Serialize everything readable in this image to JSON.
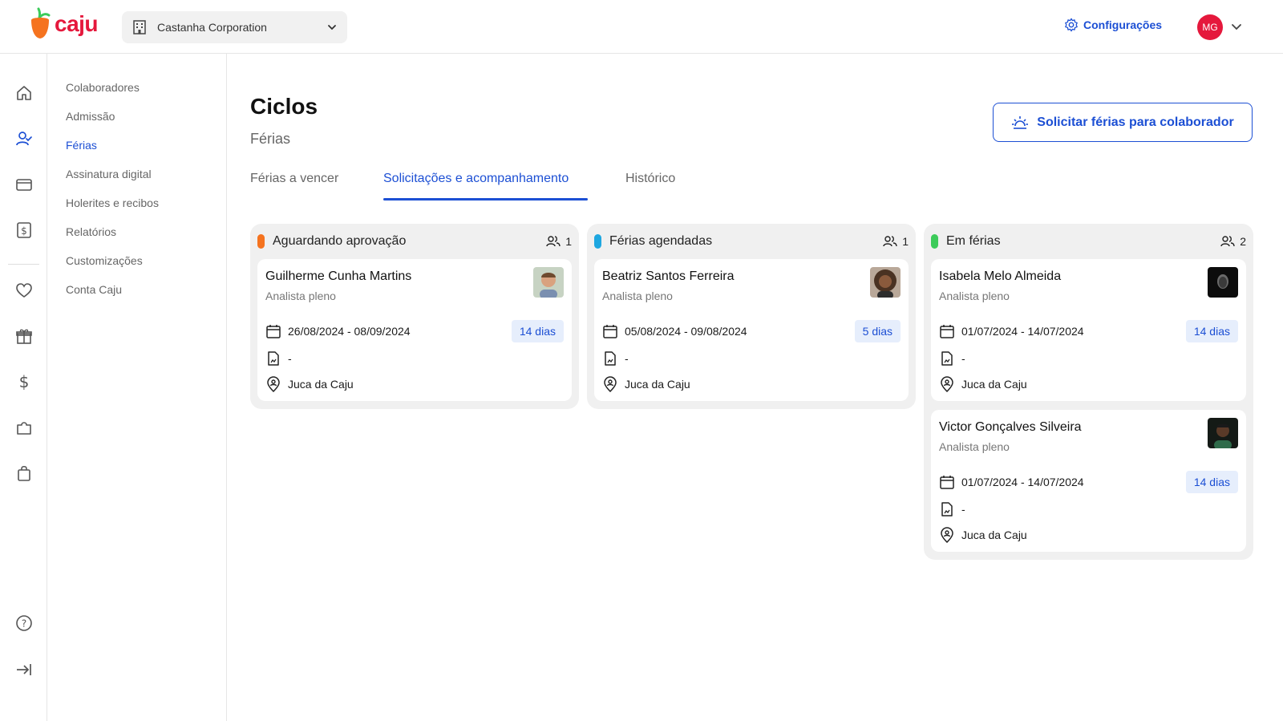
{
  "brand": {
    "name": "caju",
    "color": "#e5183c"
  },
  "topbar": {
    "company": "Castanha Corporation",
    "settings_label": "Configurações",
    "user_initials": "MG"
  },
  "subnav": {
    "items": [
      {
        "label": "Colaboradores",
        "active": false
      },
      {
        "label": "Admissão",
        "active": false
      },
      {
        "label": "Férias",
        "active": true
      },
      {
        "label": "Assinatura digital",
        "active": false
      },
      {
        "label": "Holerites e recibos",
        "active": false
      },
      {
        "label": "Relatórios",
        "active": false
      },
      {
        "label": "Customizações",
        "active": false
      },
      {
        "label": "Conta Caju",
        "active": false
      }
    ]
  },
  "page": {
    "title": "Ciclos",
    "subtitle": "Férias",
    "cta_label": "Solicitar férias para colaborador"
  },
  "tabs": [
    {
      "label": "Férias a vencer",
      "active": false
    },
    {
      "label": "Solicitações e acompanhamento",
      "active": true
    },
    {
      "label": "Histórico",
      "active": false
    }
  ],
  "columns": [
    {
      "title": "Aguardando aprovação",
      "count": "1",
      "color": "#f5731f",
      "cards": [
        {
          "name": "Guilherme Cunha Martins",
          "role": "Analista pleno",
          "period": "26/08/2024 - 08/09/2024",
          "days": "14 dias",
          "document": "-",
          "approver": "Juca da Caju"
        }
      ]
    },
    {
      "title": "Férias agendadas",
      "count": "1",
      "color": "#1ea7e0",
      "cards": [
        {
          "name": "Beatriz Santos Ferreira",
          "role": "Analista pleno",
          "period": "05/08/2024 - 09/08/2024",
          "days": "5 dias",
          "document": "-",
          "approver": "Juca da Caju"
        }
      ]
    },
    {
      "title": "Em férias",
      "count": "2",
      "color": "#3ccb5a",
      "cards": [
        {
          "name": "Isabela Melo Almeida",
          "role": "Analista pleno",
          "period": "01/07/2024 - 14/07/2024",
          "days": "14 dias",
          "document": "-",
          "approver": "Juca da Caju"
        },
        {
          "name": "Victor Gonçalves Silveira",
          "role": "Analista pleno",
          "period": "01/07/2024 - 14/07/2024",
          "days": "14 dias",
          "document": "-",
          "approver": "Juca da Caju"
        }
      ]
    }
  ]
}
